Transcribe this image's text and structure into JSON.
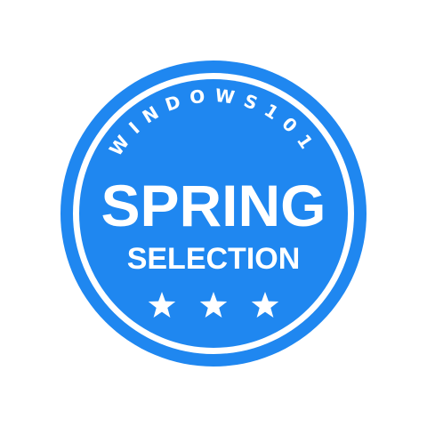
{
  "badge": {
    "arc_label": "WINDOWS101",
    "title": "SPRING",
    "subtitle": "SELECTION",
    "stars": 3,
    "colors": {
      "primary": "#1f87f0",
      "foreground": "#ffffff",
      "background": "#ffffff"
    }
  }
}
